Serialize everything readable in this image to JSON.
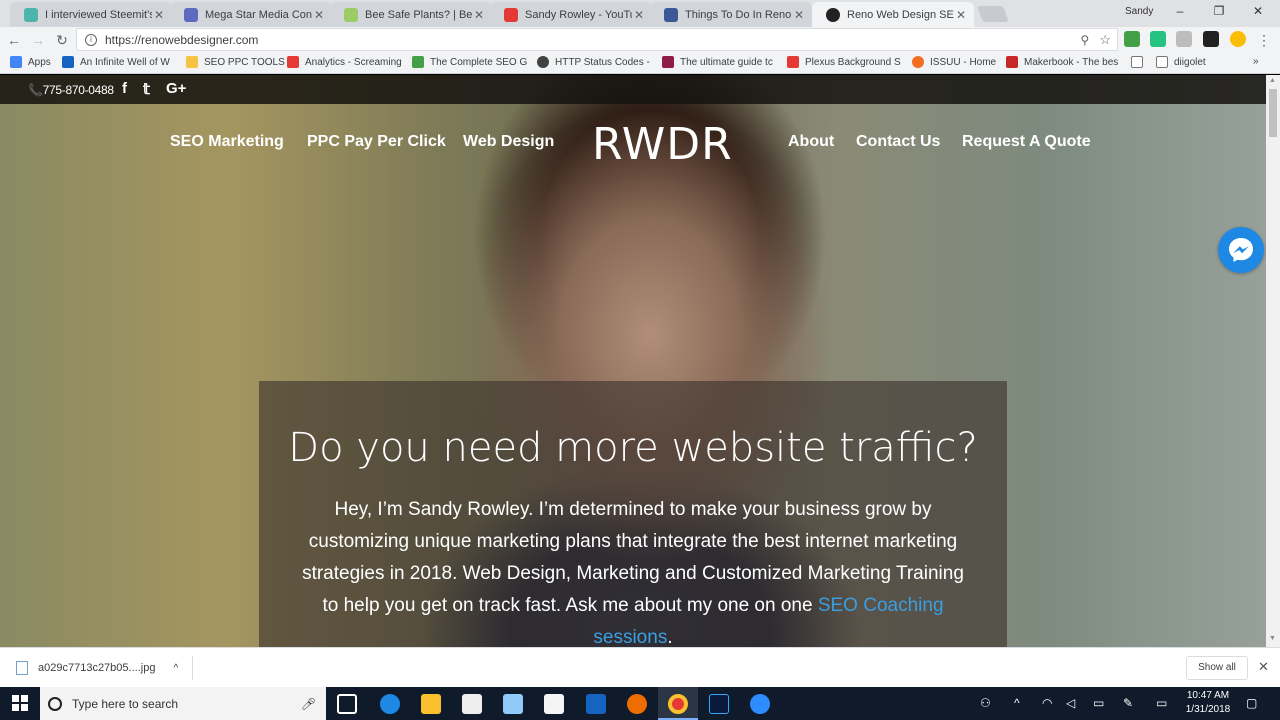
{
  "browser": {
    "tabs": [
      {
        "title": "I interviewed Steemit's A",
        "color": "#4db6ac"
      },
      {
        "title": "Mega Star Media Contra",
        "color": "#5c6bc0"
      },
      {
        "title": "Bee Safe Plants? | BeeHa",
        "color": "#9ccc65"
      },
      {
        "title": "Sandy Rowley - YouTube",
        "color": "#e53935"
      },
      {
        "title": "Things To Do In Reno",
        "color": "#3b5998"
      },
      {
        "title": "Reno Web Design SEO",
        "color": "#222222"
      }
    ],
    "profile_name": "Sandy",
    "url": "https://renowebdesigner.com",
    "bookmarks": [
      "Apps",
      "An Infinite Well of W",
      "SEO PPC TOOLS",
      "Analytics - Screaming",
      "The Complete SEO G",
      "HTTP Status Codes -",
      "The ultimate guide tc",
      "Plexus Background S",
      "ISSUU - Home",
      "Makerbook - The bes",
      "diigolet"
    ]
  },
  "site": {
    "phone": "775-870-0488",
    "social": [
      "f",
      "𝕥",
      "G+"
    ],
    "nav_left": [
      "SEO Marketing",
      "PPC Pay Per Click",
      "Web Design"
    ],
    "logo": "RWDR",
    "nav_right": [
      "About",
      "Contact Us",
      "Request A Quote"
    ],
    "hero_title": "Do you need more website traffic?",
    "hero_text": "Hey, I’m Sandy Rowley. I’m determined to make your business grow by customizing unique marketing plans that integrate the best internet marketing strategies in 2018. Web Design, Marketing and Customized Marketing Training to help you get on track fast. Ask me about my one on one ",
    "hero_link": "SEO Coaching sessions",
    "hero_end": "."
  },
  "downloads": {
    "file": "a029c7713c27b05....jpg",
    "show_all": "Show all"
  },
  "taskbar": {
    "search_placeholder": "Type here to search",
    "time": "10:47 AM",
    "date": "1/31/2018"
  }
}
